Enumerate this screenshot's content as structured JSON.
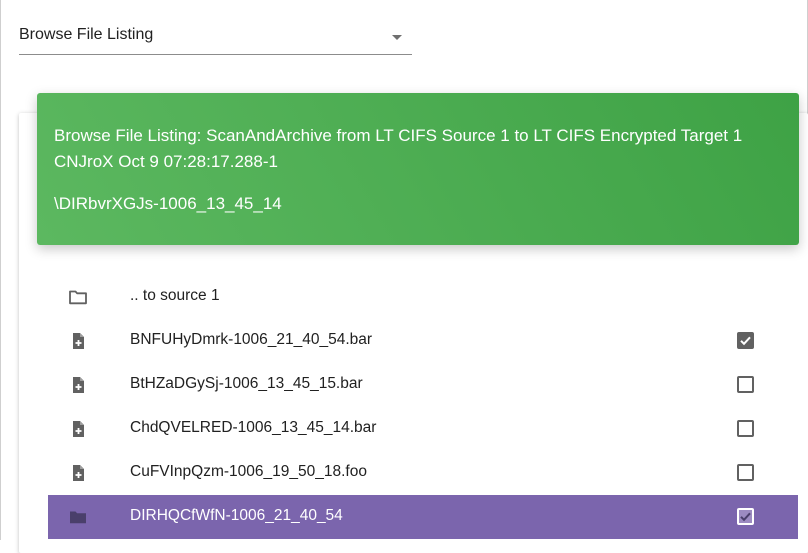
{
  "dropdown": {
    "value": "Browse File Listing",
    "icon": "caret-down-icon"
  },
  "banner": {
    "title": "Browse File Listing: ScanAndArchive from LT CIFS Source 1 to LT CIFS Encrypted Target 1 CNJroX Oct 9 07:28:17.288-1",
    "path": "\\DIRbvrXGJs-1006_13_45_14",
    "color": "#4caf50"
  },
  "list": {
    "items": [
      {
        "label": ".. to source 1",
        "icon": "folder-outline-icon",
        "checkbox": null,
        "selected": false
      },
      {
        "label": "BNFUHyDmrk-1006_21_40_54.bar",
        "icon": "file-plus-icon",
        "checkbox": true,
        "selected": false
      },
      {
        "label": "BtHZaDGySj-1006_13_45_15.bar",
        "icon": "file-plus-icon",
        "checkbox": false,
        "selected": false
      },
      {
        "label": "ChdQVELRED-1006_13_45_14.bar",
        "icon": "file-plus-icon",
        "checkbox": false,
        "selected": false
      },
      {
        "label": "CuFVInpQzm-1006_19_50_18.foo",
        "icon": "file-plus-icon",
        "checkbox": false,
        "selected": false
      },
      {
        "label": "DIRHQCfWfN-1006_21_40_54",
        "icon": "folder-icon",
        "checkbox": true,
        "selected": true
      }
    ],
    "selected_color": "#7b65ad"
  }
}
